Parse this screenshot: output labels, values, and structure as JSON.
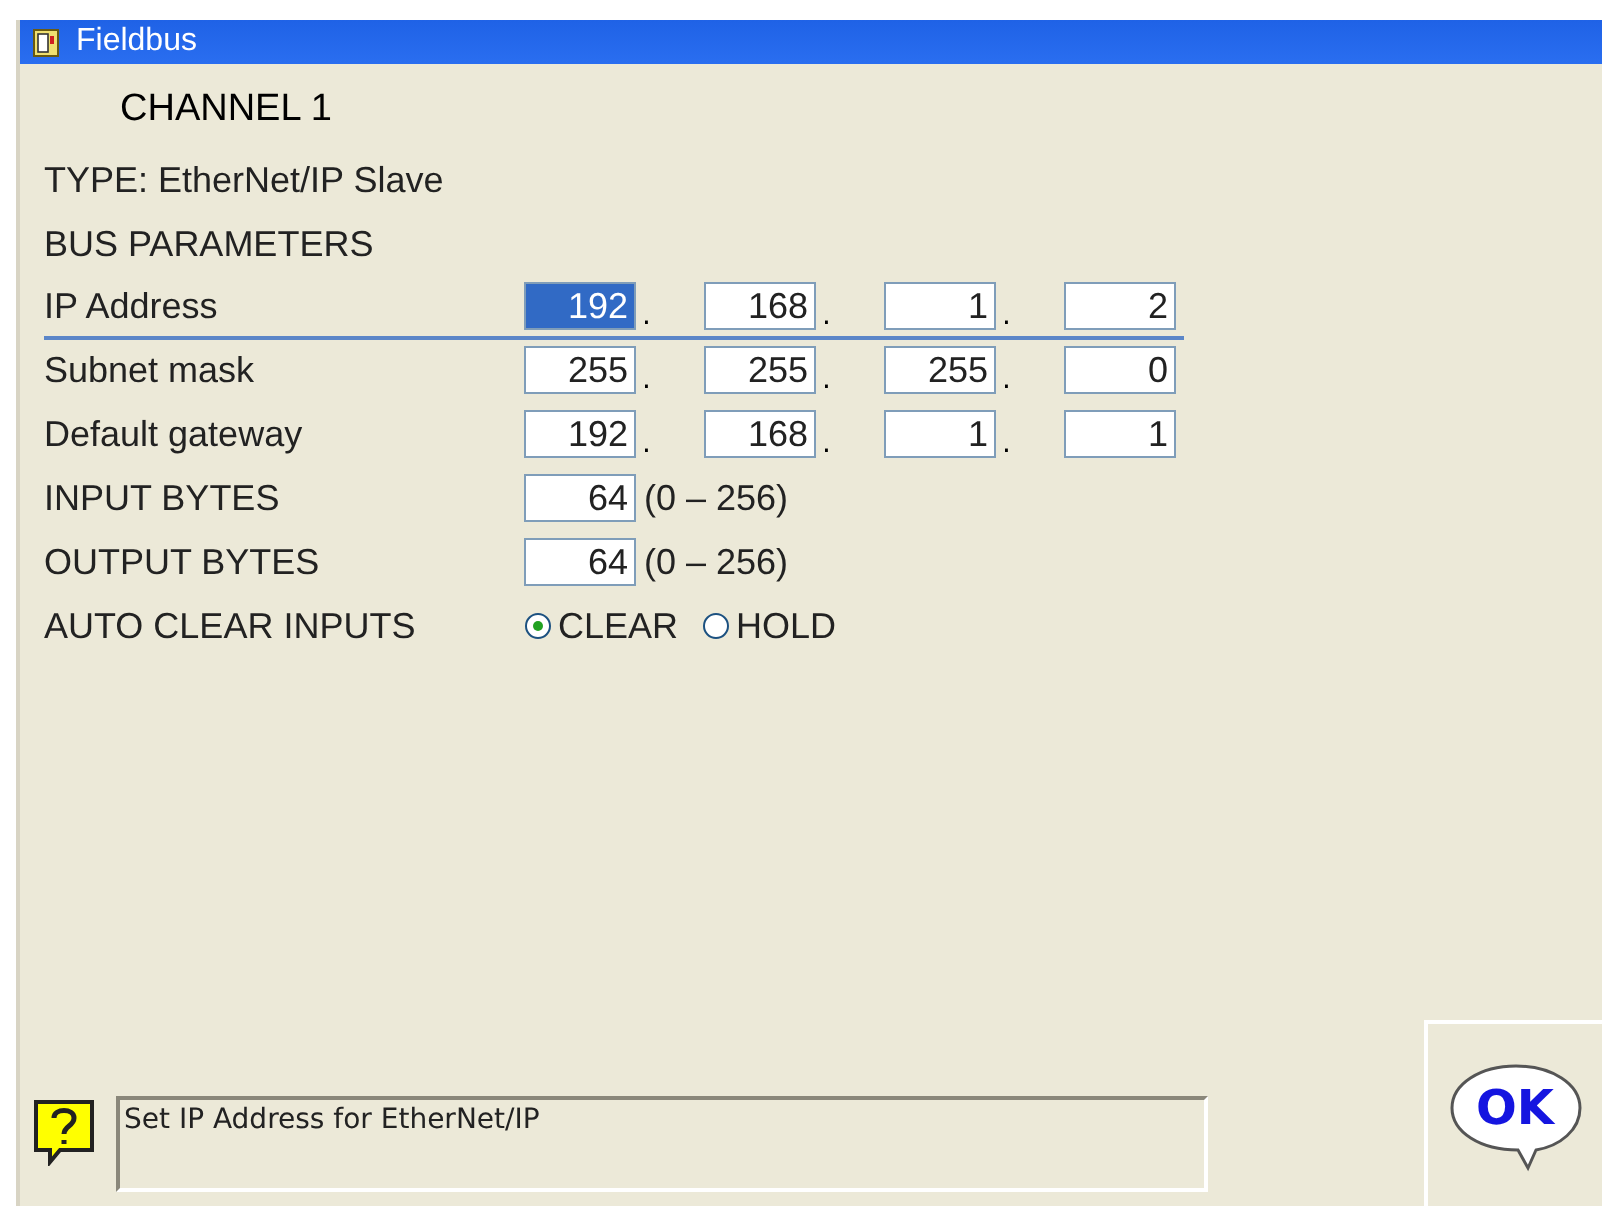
{
  "window": {
    "title": "Fieldbus"
  },
  "channel": "CHANNEL 1",
  "type_line": "TYPE:  EtherNet/IP Slave",
  "section": "BUS PARAMETERS",
  "rows": [
    {
      "kind": "ip",
      "label": "IP Address",
      "selected": true,
      "separators": [
        ".",
        ".",
        "."
      ],
      "octets": [
        {
          "value": "192",
          "selected": true
        },
        {
          "value": "168",
          "selected": false
        },
        {
          "value": "1",
          "selected": false
        },
        {
          "value": "2",
          "selected": false
        }
      ]
    },
    {
      "kind": "ip",
      "label": "Subnet mask",
      "selected": false,
      "separators": [
        ".",
        ".",
        "."
      ],
      "octets": [
        {
          "value": "255",
          "selected": false
        },
        {
          "value": "255",
          "selected": false
        },
        {
          "value": "255",
          "selected": false
        },
        {
          "value": "0",
          "selected": false
        }
      ]
    },
    {
      "kind": "ip",
      "label": "Default gateway",
      "selected": false,
      "separators": [
        ".",
        ".",
        "."
      ],
      "octets": [
        {
          "value": "192",
          "selected": false
        },
        {
          "value": "168",
          "selected": false
        },
        {
          "value": "1",
          "selected": false
        },
        {
          "value": "1",
          "selected": false
        }
      ]
    },
    {
      "kind": "number",
      "label": "INPUT BYTES",
      "selected": false,
      "value": "64",
      "range": "(0 – 256)"
    },
    {
      "kind": "number",
      "label": "OUTPUT BYTES",
      "selected": false,
      "value": "64",
      "range": "(0 – 256)"
    },
    {
      "kind": "radio",
      "label": "AUTO CLEAR INPUTS",
      "selected": false,
      "options": [
        {
          "label": "CLEAR",
          "selected": true
        },
        {
          "label": "HOLD",
          "selected": false
        }
      ]
    }
  ],
  "help_text": "Set IP Address for EtherNet/IP",
  "ok_button": "OK"
}
